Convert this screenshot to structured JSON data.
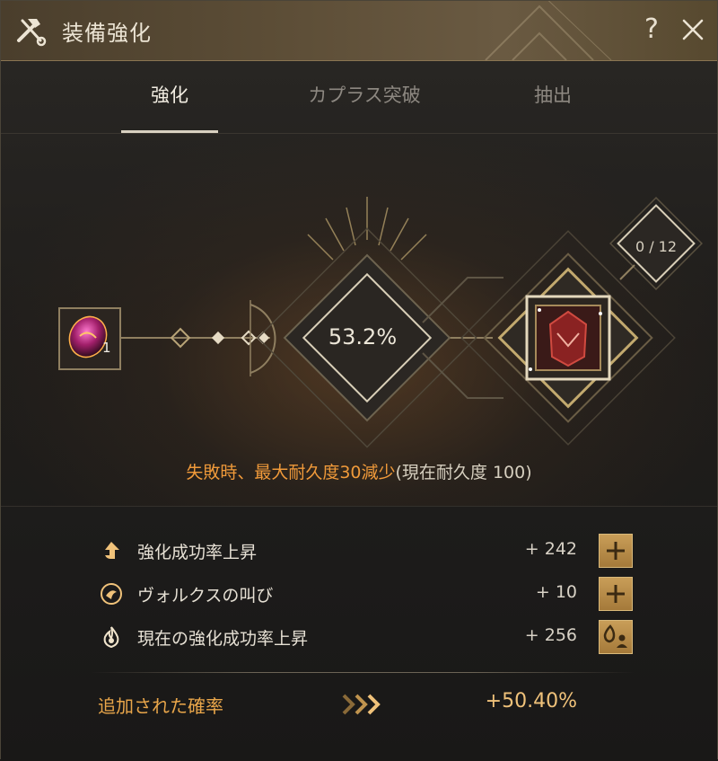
{
  "window": {
    "title": "装備強化"
  },
  "header": {
    "help_label": "?"
  },
  "tabs": [
    {
      "label": "強化",
      "active": true
    },
    {
      "label": "カプラス突破",
      "active": false
    },
    {
      "label": "抽出",
      "active": false
    }
  ],
  "enhance": {
    "material_count": "1",
    "success_rate": "53.2%",
    "failstack_count": "0 / 12",
    "warning_main": "失敗時、最大耐久度30減少",
    "warning_sub": "(現在耐久度 100)"
  },
  "bonuses": [
    {
      "icon": "arrow-up-icon",
      "label": "強化成功率上昇",
      "value": "+ 242",
      "button_icon": "plus-icon"
    },
    {
      "icon": "valks-icon",
      "label": "ヴォルクスの叫び",
      "value": "+ 10",
      "button_icon": "plus-icon"
    },
    {
      "icon": "flame-icon",
      "label": "現在の強化成功率上昇",
      "value": "+ 256",
      "button_icon": "flame-people-icon"
    }
  ],
  "added": {
    "label": "追加された確率",
    "value": "+50.40%"
  },
  "colors": {
    "accent_orange": "#f09a3a",
    "gold": "#d9b97a",
    "added_value": "#f0c27a"
  }
}
